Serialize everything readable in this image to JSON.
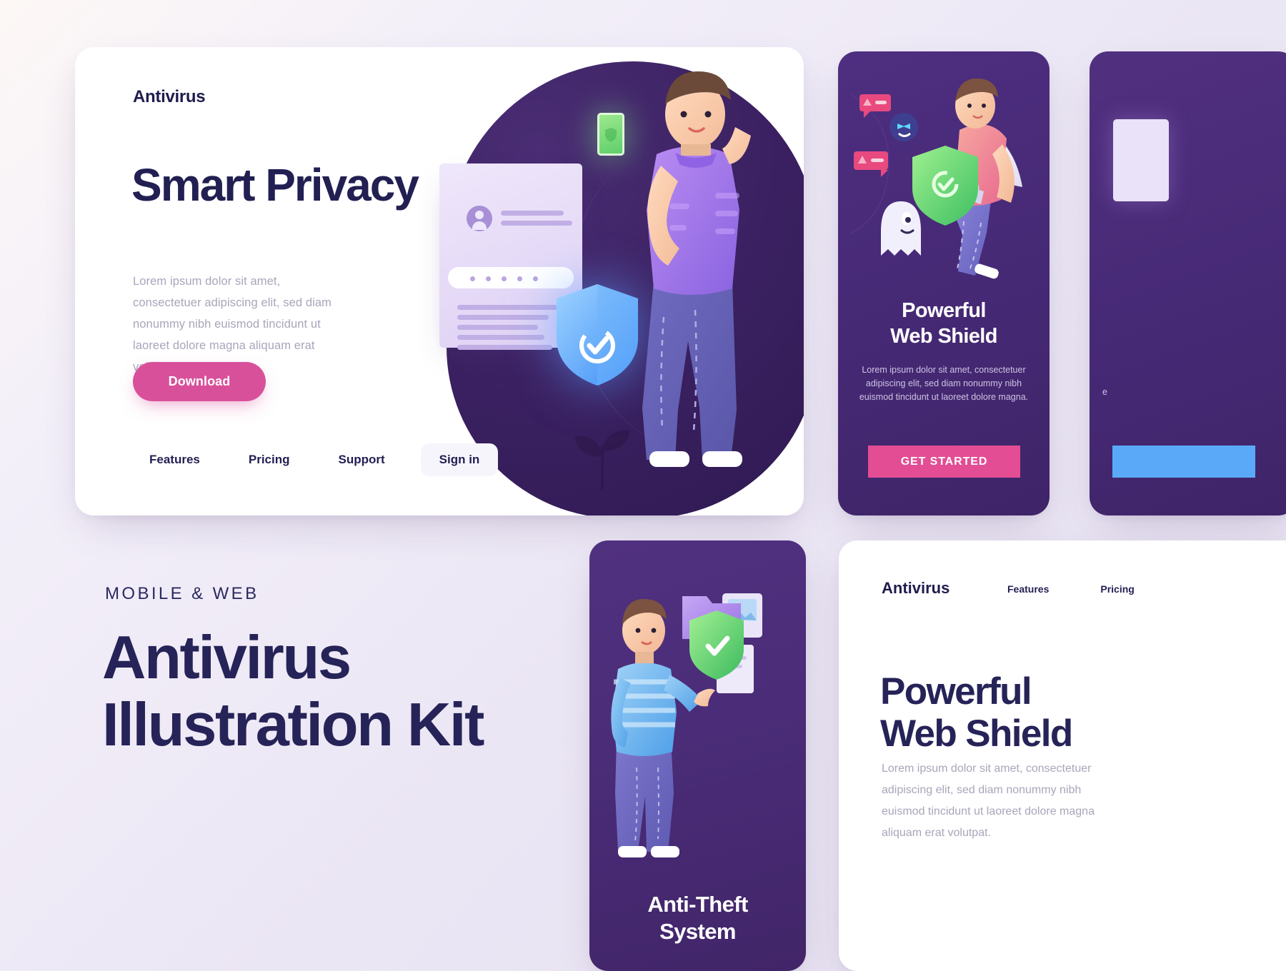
{
  "hero": {
    "logo": "Antivirus",
    "title": "Smart Privacy",
    "body": "Lorem ipsum dolor sit amet, consectetuer adipiscing elit, sed diam nonummy nibh euismod tincidunt ut laoreet dolore magna aliquam erat volutpat.",
    "cta_label": "Download",
    "nav": [
      {
        "label": "Features"
      },
      {
        "label": "Pricing"
      },
      {
        "label": "Support"
      }
    ],
    "signin_label": "Sign in",
    "art": {
      "document_icon": "login-card",
      "shield_icon": "shield-check-blue",
      "phone_icon": "phone-green-shield",
      "person_icon": "person-holding-phone"
    }
  },
  "card_shield": {
    "title_line1": "Powerful",
    "title_line2": "Web Shield",
    "body": "Lorem ipsum dolor sit amet, consectetuer adipiscing elit, sed diam nonummy nibh euismod tincidunt ut laoreet dolore magna.",
    "cta_label": "GET STARTED",
    "art": {
      "hero_icon": "superhero-with-green-shield",
      "ghost_icon": "ghost-malware",
      "bug_icon": "virus-bug",
      "alert_icon": "alert-notification"
    }
  },
  "card_partial": {
    "body_fragment": "e",
    "art": {
      "doc_icon": "document-white"
    }
  },
  "promo": {
    "kicker": "MOBILE & WEB",
    "title_line1": "Antivirus",
    "title_line2": "Illustration Kit"
  },
  "card_theft": {
    "title_line1": "Anti-Theft",
    "title_line2": "System",
    "art": {
      "person_icon": "person-striped-sweater",
      "folder_icon": "folder-purple",
      "shield_icon": "shield-check-green",
      "image_icon": "photo-file"
    }
  },
  "card_web": {
    "logo": "Antivirus",
    "nav": [
      {
        "label": "Features"
      },
      {
        "label": "Pricing"
      }
    ],
    "title_line1": "Powerful",
    "title_line2": "Web Shield",
    "body": "Lorem ipsum dolor sit amet, consectetuer adipiscing elit, sed diam nonummy nibh euismod tincidunt ut laoreet dolore magna aliquam erat volutpat."
  },
  "colors": {
    "ink": "#262358",
    "muted": "#a7a6bb",
    "pink": "#d9509a",
    "pink_cta": "#e24d94",
    "purple_card": "#472a77",
    "blue": "#5aa9f8",
    "green": "#6fd17a",
    "page_bg": "#ece7f4"
  }
}
